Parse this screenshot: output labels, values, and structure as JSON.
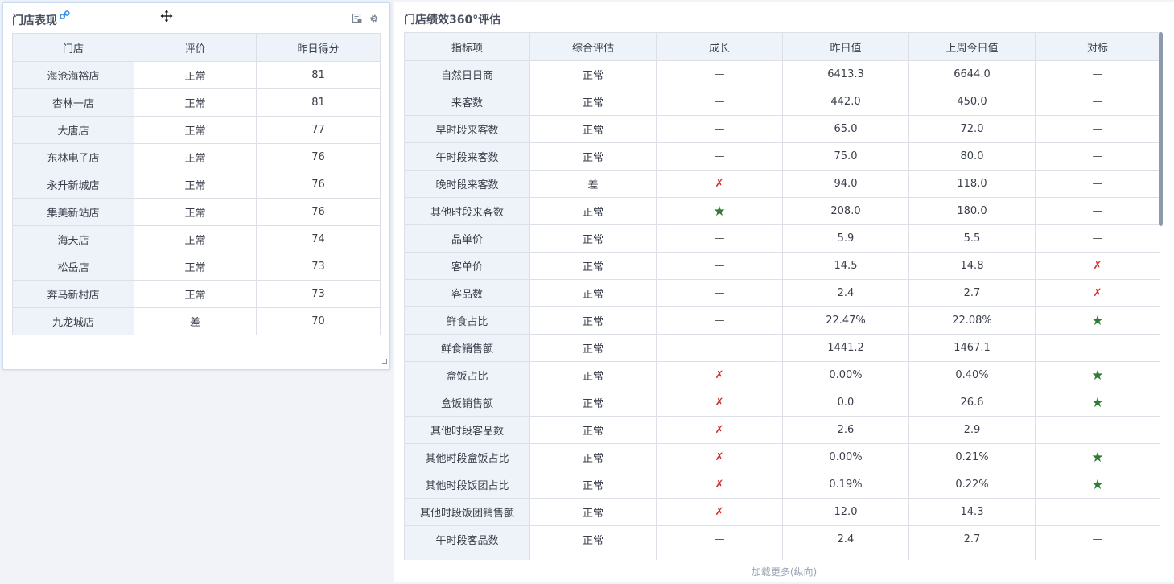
{
  "left_panel": {
    "title": "门店表现",
    "columns": [
      "门店",
      "评价",
      "昨日得分"
    ],
    "rows": [
      [
        "海沧海裕店",
        "正常",
        "81"
      ],
      [
        "杏林一店",
        "正常",
        "81"
      ],
      [
        "大唐店",
        "正常",
        "77"
      ],
      [
        "东林电子店",
        "正常",
        "76"
      ],
      [
        "永升新城店",
        "正常",
        "76"
      ],
      [
        "集美新站店",
        "正常",
        "76"
      ],
      [
        "海天店",
        "正常",
        "74"
      ],
      [
        "松岳店",
        "正常",
        "73"
      ],
      [
        "奔马新村店",
        "正常",
        "73"
      ],
      [
        "九龙城店",
        "差",
        "70"
      ]
    ]
  },
  "right_panel": {
    "title": "门店绩效360°评估",
    "columns": [
      "指标项",
      "综合评估",
      "成长",
      "昨日值",
      "上周今日值",
      "对标"
    ],
    "rows": [
      [
        "自然日日商",
        "正常",
        "dash",
        "6413.3",
        "6644.0",
        "dash"
      ],
      [
        "来客数",
        "正常",
        "dash",
        "442.0",
        "450.0",
        "dash"
      ],
      [
        "早时段来客数",
        "正常",
        "dash",
        "65.0",
        "72.0",
        "dash"
      ],
      [
        "午时段来客数",
        "正常",
        "dash",
        "75.0",
        "80.0",
        "dash"
      ],
      [
        "晚时段来客数",
        "差",
        "cross",
        "94.0",
        "118.0",
        "dash"
      ],
      [
        "其他时段来客数",
        "正常",
        "star",
        "208.0",
        "180.0",
        "dash"
      ],
      [
        "品单价",
        "正常",
        "dash",
        "5.9",
        "5.5",
        "dash"
      ],
      [
        "客单价",
        "正常",
        "dash",
        "14.5",
        "14.8",
        "cross"
      ],
      [
        "客品数",
        "正常",
        "dash",
        "2.4",
        "2.7",
        "cross"
      ],
      [
        "鲜食占比",
        "正常",
        "dash",
        "22.47%",
        "22.08%",
        "star"
      ],
      [
        "鲜食销售额",
        "正常",
        "dash",
        "1441.2",
        "1467.1",
        "dash"
      ],
      [
        "盒饭占比",
        "正常",
        "cross",
        "0.00%",
        "0.40%",
        "star"
      ],
      [
        "盒饭销售额",
        "正常",
        "cross",
        "0.0",
        "26.6",
        "star"
      ],
      [
        "其他时段客品数",
        "正常",
        "cross",
        "2.6",
        "2.9",
        "dash"
      ],
      [
        "其他时段盒饭占比",
        "正常",
        "cross",
        "0.00%",
        "0.21%",
        "star"
      ],
      [
        "其他时段饭团占比",
        "正常",
        "cross",
        "0.19%",
        "0.22%",
        "star"
      ],
      [
        "其他时段饭团销售额",
        "正常",
        "cross",
        "12.0",
        "14.3",
        "dash"
      ],
      [
        "午时段客品数",
        "正常",
        "dash",
        "2.4",
        "2.7",
        "dash"
      ],
      [
        "",
        "",
        "",
        "",
        "",
        ""
      ]
    ],
    "load_more": "加载更多(纵向)"
  },
  "icons": {
    "link": "link-icon",
    "move": "move-icon",
    "export": "export-icon",
    "settings": "gear-icon",
    "resize": "resize-icon"
  },
  "marks": {
    "dash": "—",
    "cross": "✗",
    "star": "★"
  },
  "colors": {
    "accent_link": "#2f8de4",
    "header_bg": "#eef3fa",
    "cross": "#d0302a",
    "star": "#2e7d32"
  }
}
